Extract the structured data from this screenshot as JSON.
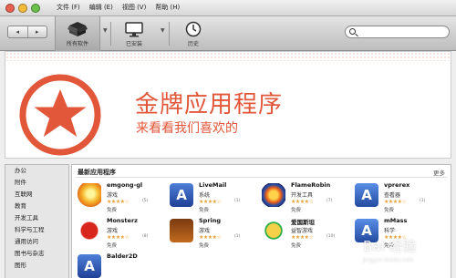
{
  "menubar": {
    "file": "文件 (F)",
    "edit": "编辑 (E)",
    "view": "视图 (V)",
    "help": "帮助 (H)"
  },
  "toolbar": {
    "back": "◂",
    "forward": "▸",
    "all_software": "所有软件",
    "installed": "已安装",
    "history": "历史",
    "search_placeholder": ""
  },
  "banner": {
    "title": "金牌应用程序",
    "subtitle": "来看看我们喜欢的"
  },
  "sidebar": {
    "items": [
      "办公",
      "附件",
      "互联网",
      "教育",
      "开发工具",
      "科学与工程",
      "通用访问",
      "图书与杂志",
      "图形"
    ]
  },
  "section": {
    "title": "最新应用程序",
    "more": "更多"
  },
  "apps": [
    {
      "name": "emgong-gl",
      "category": "游戏",
      "stars": "★★★★☆",
      "count": "(5)",
      "price": "免费"
    },
    {
      "name": "LiveMail",
      "category": "系统",
      "stars": "★★★★☆",
      "count": "(1)",
      "price": "免费"
    },
    {
      "name": "FlameRobin",
      "category": "开发工具",
      "stars": "★★★★☆",
      "count": "(7)",
      "price": "免费"
    },
    {
      "name": "vprerex",
      "category": "查看器",
      "stars": "★★★★☆",
      "count": "(1)",
      "price": "免费"
    },
    {
      "name": "Monsterz",
      "category": "游戏",
      "stars": "★★★★☆",
      "count": "(8)",
      "price": "免费"
    },
    {
      "name": "Spring",
      "category": "游戏",
      "stars": "★★★★☆",
      "count": "(1)",
      "price": "免费"
    },
    {
      "name": "爱国斯坦",
      "category": "益智游戏",
      "stars": "★★★★☆",
      "count": "(10)",
      "price": "免费"
    },
    {
      "name": "mMass",
      "category": "科学",
      "stars": "★★★★☆",
      "count": "",
      "price": "免费"
    },
    {
      "name": "Balder2D",
      "category": "",
      "stars": "",
      "count": "",
      "price": ""
    }
  ],
  "watermark": {
    "text": "Bai 经验",
    "sub": "jingyan.baidu.com"
  },
  "colors": {
    "accent": "#e2573a",
    "stars": "#e6a13a"
  }
}
